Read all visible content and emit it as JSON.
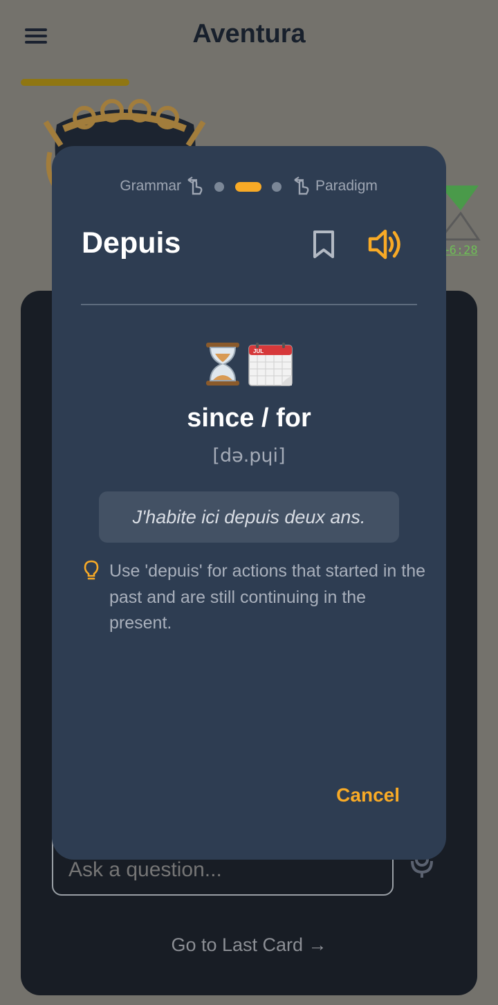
{
  "app": {
    "title": "Aventura"
  },
  "progress": {
    "fraction": 0.22,
    "color": "#8f7612"
  },
  "timer": {
    "delta": "+6:28",
    "color": "#6fbe57"
  },
  "chat": {
    "input_placeholder": "Ask a question...",
    "go_last_card": "Go to Last Card →"
  },
  "card": {
    "pager": {
      "left_label": "Grammar",
      "right_label": "Paradigm",
      "active_index": 1,
      "count": 3
    },
    "word": "Depuis",
    "translation": "since / for",
    "phonetic": "[də.pɥi]",
    "example": "J'habite ici depuis deux ans.",
    "tip": "Use 'depuis' for actions that started in the past and are still continuing in the present.",
    "cancel_label": "Cancel",
    "icons": [
      "bookmark-icon",
      "speaker-icon",
      "hourglass-emoji",
      "calendar-emoji",
      "lightbulb-icon"
    ]
  },
  "colors": {
    "accent": "#f8aa26",
    "card_bg": "#2e3d52",
    "overlay": "#74726c"
  }
}
